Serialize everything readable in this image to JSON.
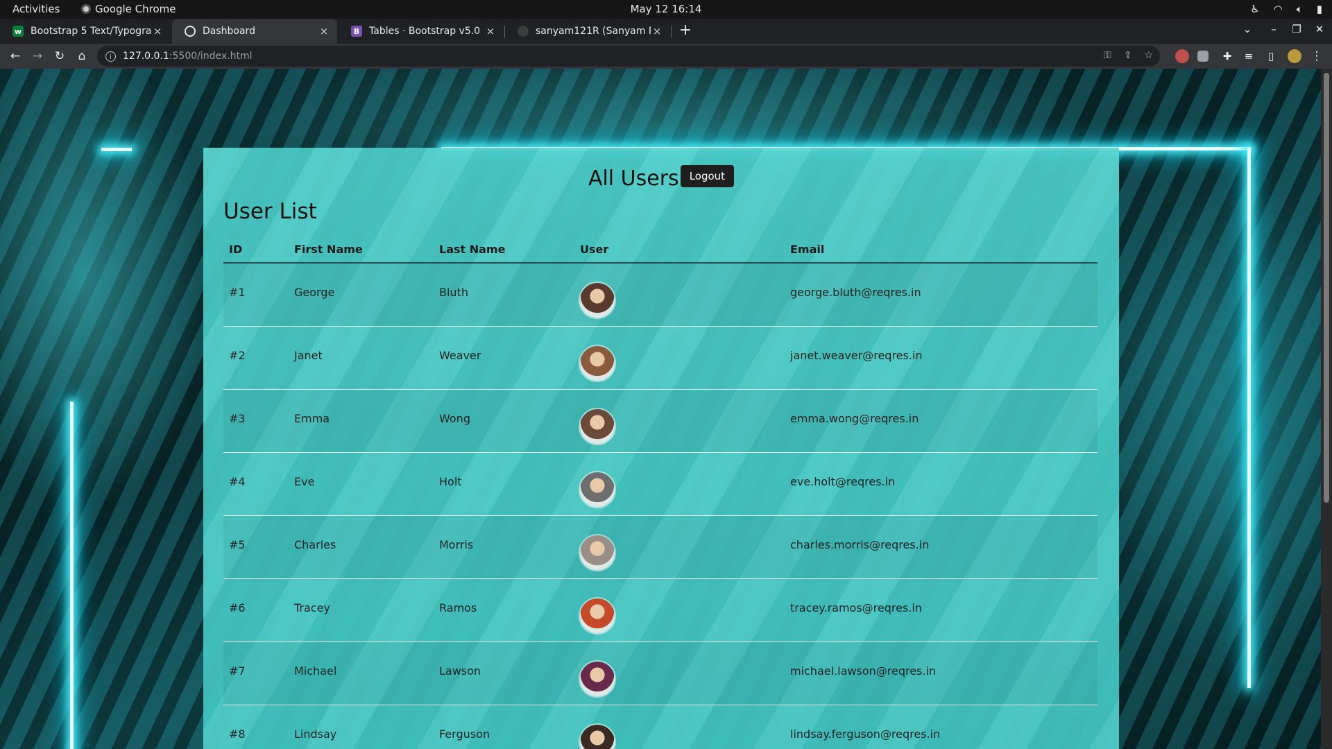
{
  "system": {
    "activities": "Activities",
    "app_name": "Google Chrome",
    "clock": "May 12  16:14"
  },
  "tabs": [
    {
      "title": "Bootstrap 5 Text/Typogra",
      "close": "×",
      "favicon_color": "#0a7f3a"
    },
    {
      "title": "Dashboard",
      "close": "×",
      "favicon_color": "#e8eaed"
    },
    {
      "title": "Tables · Bootstrap v5.0",
      "close": "×",
      "favicon_color": "#7952b3",
      "favicon_letter": "B"
    },
    {
      "title": "sanyam121R (Sanyam Rat",
      "close": "×",
      "favicon_color": "#3c3c3c"
    }
  ],
  "new_tab": "+",
  "address": {
    "host": "127.0.0.1",
    "path": ":5500/index.html"
  },
  "page": {
    "title": "All Users",
    "logout_label": "Logout",
    "subtitle": "User List",
    "columns": [
      "ID",
      "First Name",
      "Last Name",
      "User",
      "Email"
    ],
    "users": [
      {
        "id": "#1",
        "first": "George",
        "last": "Bluth",
        "email": "george.bluth@reqres.in",
        "avatar_color": "#5a3b2e"
      },
      {
        "id": "#2",
        "first": "Janet",
        "last": "Weaver",
        "email": "janet.weaver@reqres.in",
        "avatar_color": "#8a5a3c"
      },
      {
        "id": "#3",
        "first": "Emma",
        "last": "Wong",
        "email": "emma.wong@reqres.in",
        "avatar_color": "#6b4a3a"
      },
      {
        "id": "#4",
        "first": "Eve",
        "last": "Holt",
        "email": "eve.holt@reqres.in",
        "avatar_color": "#6e6e6e"
      },
      {
        "id": "#5",
        "first": "Charles",
        "last": "Morris",
        "email": "charles.morris@reqres.in",
        "avatar_color": "#9a8f86"
      },
      {
        "id": "#6",
        "first": "Tracey",
        "last": "Ramos",
        "email": "tracey.ramos@reqres.in",
        "avatar_color": "#c44a2a"
      },
      {
        "id": "#7",
        "first": "Michael",
        "last": "Lawson",
        "email": "michael.lawson@reqres.in",
        "avatar_color": "#6a2a4a"
      },
      {
        "id": "#8",
        "first": "Lindsay",
        "last": "Ferguson",
        "email": "lindsay.ferguson@reqres.in",
        "avatar_color": "#3a2a22"
      }
    ]
  },
  "colors": {
    "panel": "#4fd2cc",
    "neon": "#4ff3ff",
    "chrome_dark": "#202124"
  }
}
